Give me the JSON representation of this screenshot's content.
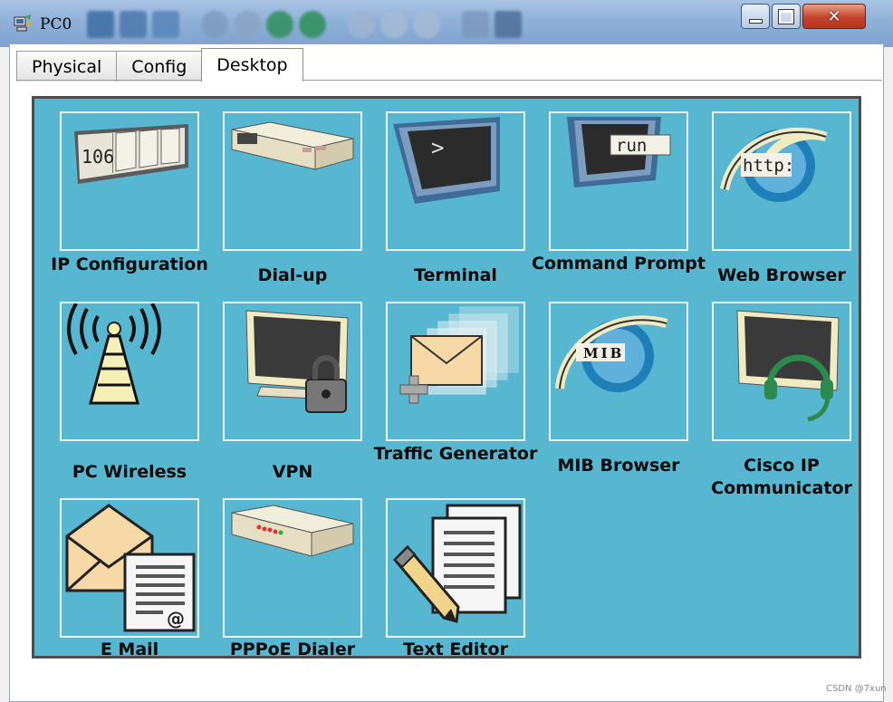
{
  "window": {
    "title": "PC0",
    "controls": [
      "minimize",
      "maximize",
      "close"
    ]
  },
  "tabs": [
    {
      "label": "Physical",
      "active": false
    },
    {
      "label": "Config",
      "active": false
    },
    {
      "label": "Desktop",
      "active": true
    }
  ],
  "apps": [
    {
      "label": "IP Configuration",
      "icon": "ip-configuration-icon",
      "icon_text": "106"
    },
    {
      "label": "Dial-up",
      "icon": "modem-icon"
    },
    {
      "label": "Terminal",
      "icon": "terminal-icon",
      "icon_text": ">"
    },
    {
      "label": "Command Prompt",
      "icon": "command-prompt-icon",
      "icon_text": "run"
    },
    {
      "label": "Web Browser",
      "icon": "web-browser-icon",
      "icon_text": "http:"
    },
    {
      "label": "PC Wireless",
      "icon": "wireless-tower-icon"
    },
    {
      "label": "VPN",
      "icon": "vpn-lock-icon"
    },
    {
      "label": "Traffic Generator",
      "icon": "traffic-generator-icon"
    },
    {
      "label": "MIB Browser",
      "icon": "mib-browser-icon",
      "icon_text": "MIB"
    },
    {
      "label": "Cisco IP Communicator",
      "icon": "ip-communicator-headset-icon"
    },
    {
      "label": "E Mail",
      "icon": "email-icon"
    },
    {
      "label": "PPPoE Dialer",
      "icon": "pppoe-dialer-icon"
    },
    {
      "label": "Text Editor",
      "icon": "text-editor-icon"
    }
  ],
  "watermark": "CSDN @7xun",
  "colors": {
    "desktop_bg": "#58b7d0",
    "tile_border": "#e9f5f9",
    "titlebar": "#8fb0d8",
    "close_button": "#c5432a"
  }
}
